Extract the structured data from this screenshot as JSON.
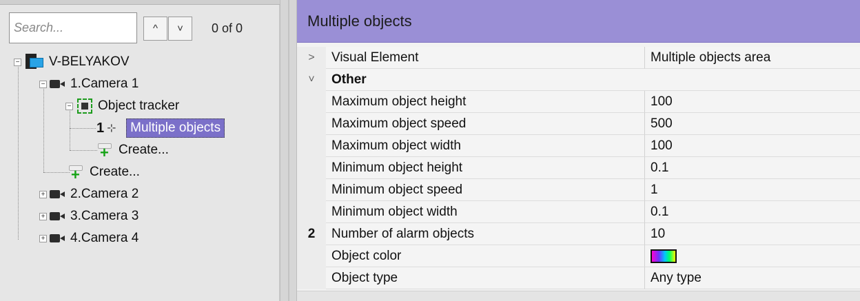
{
  "left_panel": {
    "search_placeholder": "Search...",
    "nav_up": "^",
    "nav_down": "˅",
    "match_count": "0 of 0",
    "tree": {
      "host": "V-BELYAKOV",
      "camera1": "1.Camera 1",
      "tracker": "Object tracker",
      "multi_marker": "1",
      "multi": "Multiple objects",
      "create_child": "Create...",
      "create_camera": "Create...",
      "camera2": "2.Camera 2",
      "camera3": "3.Camera 3",
      "camera4": "4.Camera 4"
    }
  },
  "right_panel": {
    "title": "Multiple objects",
    "visual_element": {
      "name": "Visual Element",
      "value": "Multiple objects area"
    },
    "group_other": "Other",
    "marker_2": "2",
    "properties": [
      {
        "name": "Maximum object height",
        "value": "100"
      },
      {
        "name": "Maximum object speed",
        "value": "500"
      },
      {
        "name": "Maximum object width",
        "value": "100"
      },
      {
        "name": "Minimum object height",
        "value": "0.1"
      },
      {
        "name": "Minimum object speed",
        "value": "1"
      },
      {
        "name": "Minimum object width",
        "value": "0.1"
      },
      {
        "name": "Number of alarm objects",
        "value": "10"
      },
      {
        "name": "Object color",
        "value": ""
      },
      {
        "name": "Object type",
        "value": "Any type"
      }
    ]
  },
  "colors": {
    "header_bg": "#9a8fd6",
    "selection_bg": "#7b70c9"
  }
}
